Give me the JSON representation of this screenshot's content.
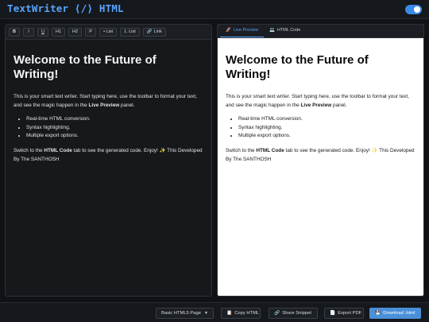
{
  "app": {
    "title": "TextWriter ⟨/⟩ HTML"
  },
  "theme_toggle": {
    "state": "on"
  },
  "toolbar": {
    "bold": "B",
    "italic": "I",
    "underline": "U",
    "h1": "H1",
    "h2": "H2",
    "paragraph": "P",
    "bullet_list": "• List",
    "numbered_list": "1. List",
    "link": "Link"
  },
  "content": {
    "heading": "Welcome to the Future of Writing!",
    "p1_a": "This is your smart text writer. Start typing here, use the toolbar to format your text, and see the magic happen in the ",
    "p1_bold": "Live Preview",
    "p1_b": " panel.",
    "list": [
      "Real-time HTML conversion.",
      "Syntax highlighting.",
      "Multiple export options."
    ],
    "p2_a": "Switch to the ",
    "p2_bold": "HTML Code",
    "p2_b": " tab to see the generated code. Enjoy! ✨ This Developed By The SANTHOSH"
  },
  "tabs": {
    "live_preview": "Live Preview",
    "html_code": "HTML Code"
  },
  "footer": {
    "template_select": "Basic HTML5 Page",
    "copy_html": "Copy HTML",
    "share_snippet": "Share Snippet",
    "export_pdf": "Export PDF",
    "download": "Download .html"
  },
  "colors": {
    "accent": "#58a6ff",
    "background": "#101216",
    "panel": "#16181b",
    "download_button": "#4a90d9"
  }
}
